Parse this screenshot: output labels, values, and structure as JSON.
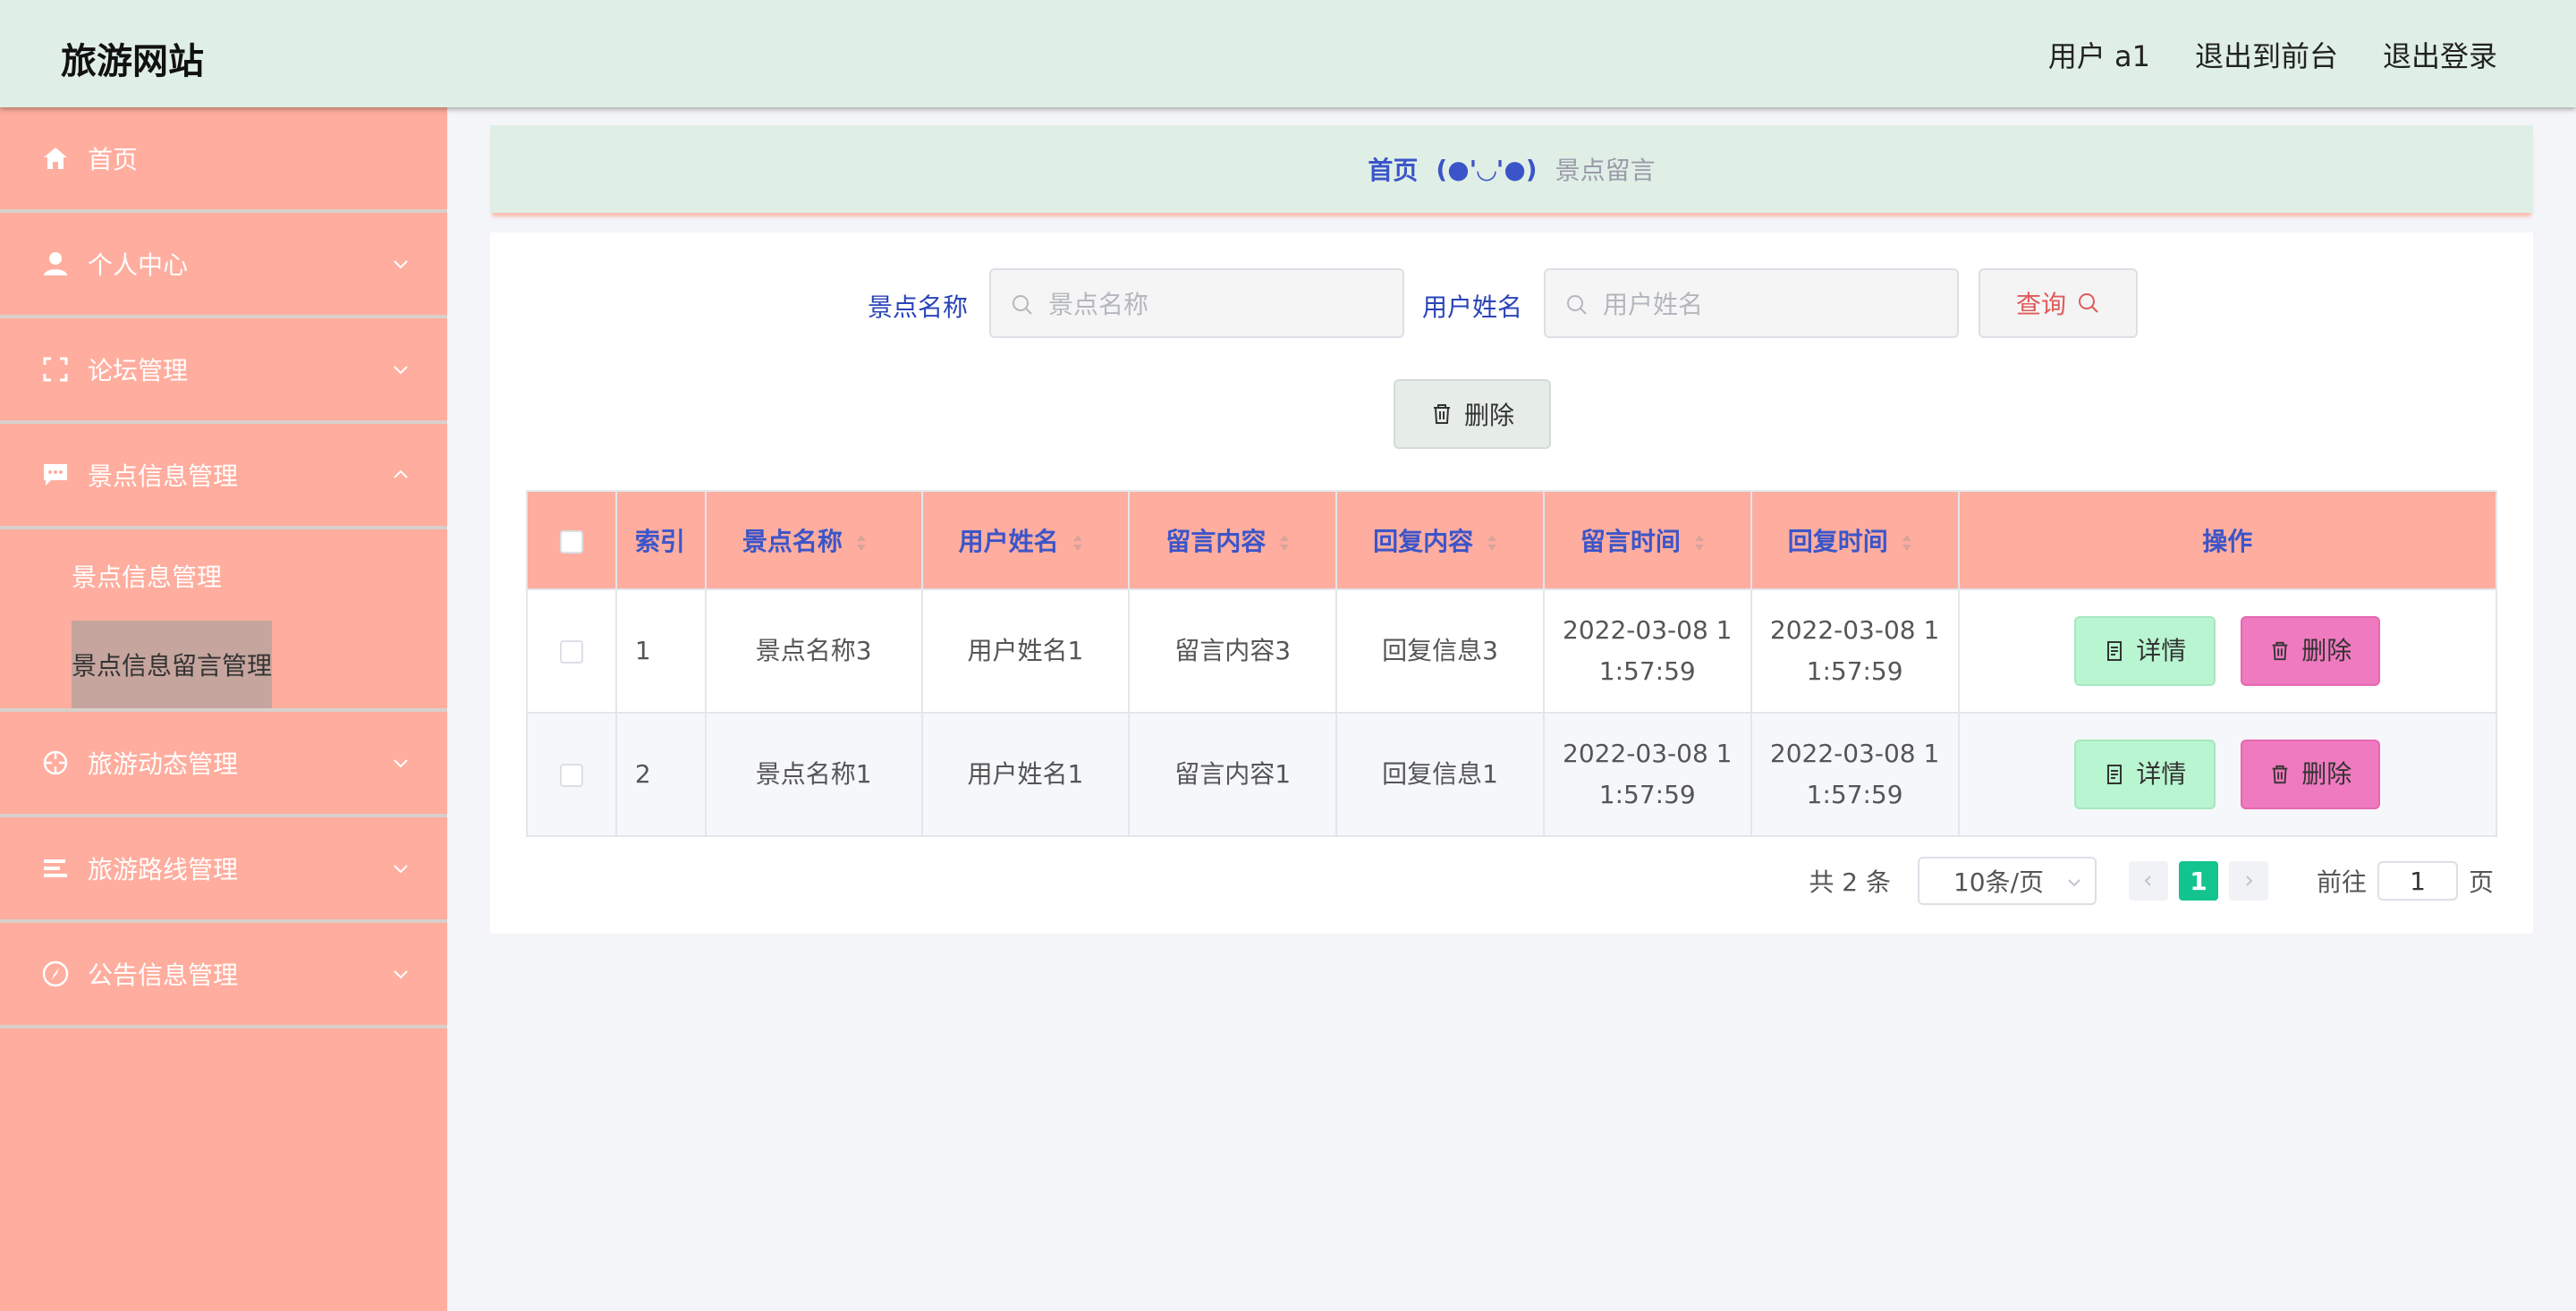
{
  "header": {
    "brand": "旅游网站",
    "user": "用户 a1",
    "exit_front": "退出到前台",
    "logout": "退出登录"
  },
  "sidebar": {
    "items": [
      {
        "label": "首页",
        "icon": "home-icon"
      },
      {
        "label": "个人中心",
        "icon": "user-icon"
      },
      {
        "label": "论坛管理",
        "icon": "frame-icon"
      },
      {
        "label": "景点信息管理",
        "icon": "chat-icon"
      },
      {
        "label": "旅游动态管理",
        "icon": "target-icon"
      },
      {
        "label": "旅游路线管理",
        "icon": "list-icon"
      },
      {
        "label": "公告信息管理",
        "icon": "compass-icon"
      }
    ],
    "sub_items": [
      {
        "label": "景点信息管理"
      },
      {
        "label": "景点信息留言管理"
      }
    ]
  },
  "breadcrumb": {
    "home": "首页",
    "separator": "(●'◡'●)",
    "current": "景点留言"
  },
  "search": {
    "spot_label": "景点名称",
    "spot_placeholder": "景点名称",
    "user_label": "用户姓名",
    "user_placeholder": "用户姓名",
    "query": "查询"
  },
  "actions": {
    "delete": "删除"
  },
  "table": {
    "headers": [
      "索引",
      "景点名称",
      "用户姓名",
      "留言内容",
      "回复内容",
      "留言时间",
      "回复时间",
      "操作"
    ],
    "rows": [
      {
        "index": "1",
        "spot": "景点名称3",
        "user": "用户姓名1",
        "content": "留言内容3",
        "reply": "回复信息3",
        "msg_time_a": "2022-03-08 1",
        "msg_time_b": "1:57:59",
        "reply_time_a": "2022-03-08 1",
        "reply_time_b": "1:57:59"
      },
      {
        "index": "2",
        "spot": "景点名称1",
        "user": "用户姓名1",
        "content": "留言内容1",
        "reply": "回复信息1",
        "msg_time_a": "2022-03-08 1",
        "msg_time_b": "1:57:59",
        "reply_time_a": "2022-03-08 1",
        "reply_time_b": "1:57:59"
      }
    ],
    "detail_label": "详情",
    "delete_label": "删除"
  },
  "pagination": {
    "total": "共 2 条",
    "page_size": "10条/页",
    "current_page": "1",
    "goto_label": "前往",
    "goto_value": "1",
    "page_suffix": "页"
  },
  "colors": {
    "sidebar": "#ffad9e",
    "header": "#e0efe6",
    "accent_blue": "#3b55c9",
    "detail_btn": "#b8f5d0",
    "delete_btn": "#f07abf",
    "page_active": "#13c48e"
  }
}
